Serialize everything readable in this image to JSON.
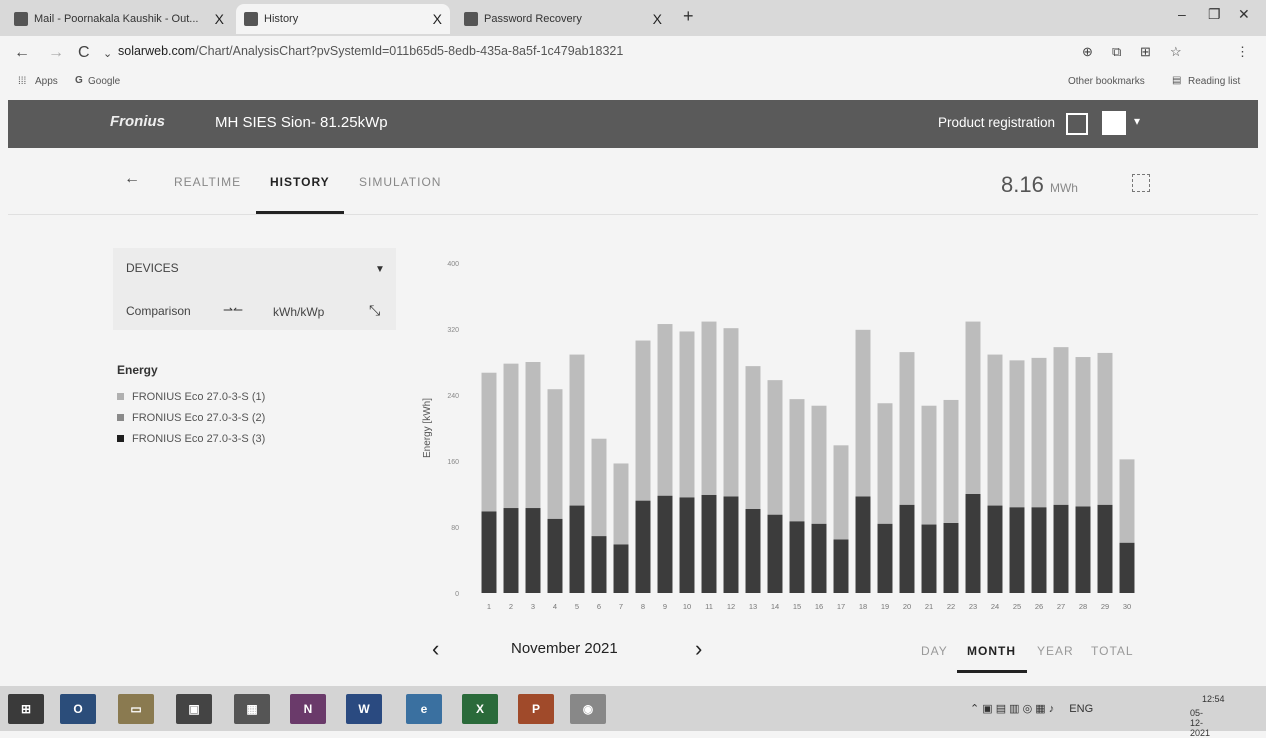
{
  "browser": {
    "tabs": [
      {
        "label": "Mail - Poornakala Kaushik - Out...",
        "close": "X"
      },
      {
        "label": "History",
        "close": "X"
      },
      {
        "label": "Password Recovery",
        "close": "X"
      }
    ],
    "new_tab": "+",
    "url_domain": "solarweb.com",
    "url_path": "/Chart/AnalysisChart?pvSystemId=011b65d5-8edb-435a-8a5f-1c479ab18321",
    "bookmarks": {
      "apps": "Apps",
      "google": "Google",
      "other": "Other bookmarks",
      "reading": "Reading list"
    }
  },
  "header": {
    "logo": "Fronius",
    "system_name": "MH SIES Sion- 81.25kWp",
    "product_registration": "Product registration"
  },
  "subnav": {
    "back": "←",
    "tabs": [
      "REALTIME",
      "HISTORY",
      "SIMULATION"
    ],
    "total_value": "8.16",
    "total_unit": "MWh"
  },
  "sidepanel": {
    "devices": "DEVICES",
    "comparison": "Comparison",
    "unit_toggle": "kWh/kWp",
    "legend_title": "Energy",
    "legend": [
      {
        "label": "FRONIUS Eco 27.0-3-S (1)",
        "color": "#b0b0b0"
      },
      {
        "label": "FRONIUS Eco 27.0-3-S (2)",
        "color": "#8a8a8a"
      },
      {
        "label": "FRONIUS Eco 27.0-3-S (3)",
        "color": "#1e1e1e"
      }
    ]
  },
  "chart_data": {
    "type": "bar",
    "stacked": true,
    "ylabel": "Energy [kWh]",
    "yticks": [
      0,
      80,
      160,
      240,
      320,
      400
    ],
    "ylim": [
      0,
      400
    ],
    "categories": [
      "1",
      "2",
      "3",
      "4",
      "5",
      "6",
      "7",
      "8",
      "9",
      "10",
      "11",
      "12",
      "13",
      "14",
      "15",
      "16",
      "17",
      "18",
      "19",
      "20",
      "21",
      "22",
      "23",
      "24",
      "25",
      "26",
      "27",
      "28",
      "29",
      "30"
    ],
    "series": [
      {
        "name": "FRONIUS Eco 27.0-3-S (3)",
        "color": "#3c3c3c",
        "values": [
          99,
          103,
          103,
          90,
          106,
          69,
          59,
          112,
          118,
          116,
          119,
          117,
          102,
          95,
          87,
          84,
          65,
          117,
          84,
          107,
          83,
          85,
          120,
          106,
          104,
          104,
          107,
          105,
          107,
          61
        ]
      },
      {
        "name": "FRONIUS Eco 27.0-3-S (1)",
        "color": "#bcbcbc",
        "values": [
          168,
          175,
          177,
          157,
          183,
          118,
          98,
          194,
          208,
          201,
          210,
          204,
          173,
          163,
          148,
          143,
          114,
          202,
          146,
          185,
          144,
          149,
          209,
          183,
          178,
          181,
          191,
          181,
          184,
          101
        ]
      }
    ],
    "grid": false
  },
  "period_nav": {
    "prev": "‹",
    "month": "November 2021",
    "next": "›",
    "options": [
      "DAY",
      "MONTH",
      "YEAR",
      "TOTAL"
    ]
  },
  "taskbar": {
    "tray_lang": "ENG",
    "tray_time": "12:54",
    "tray_date": "05-12-2021"
  }
}
